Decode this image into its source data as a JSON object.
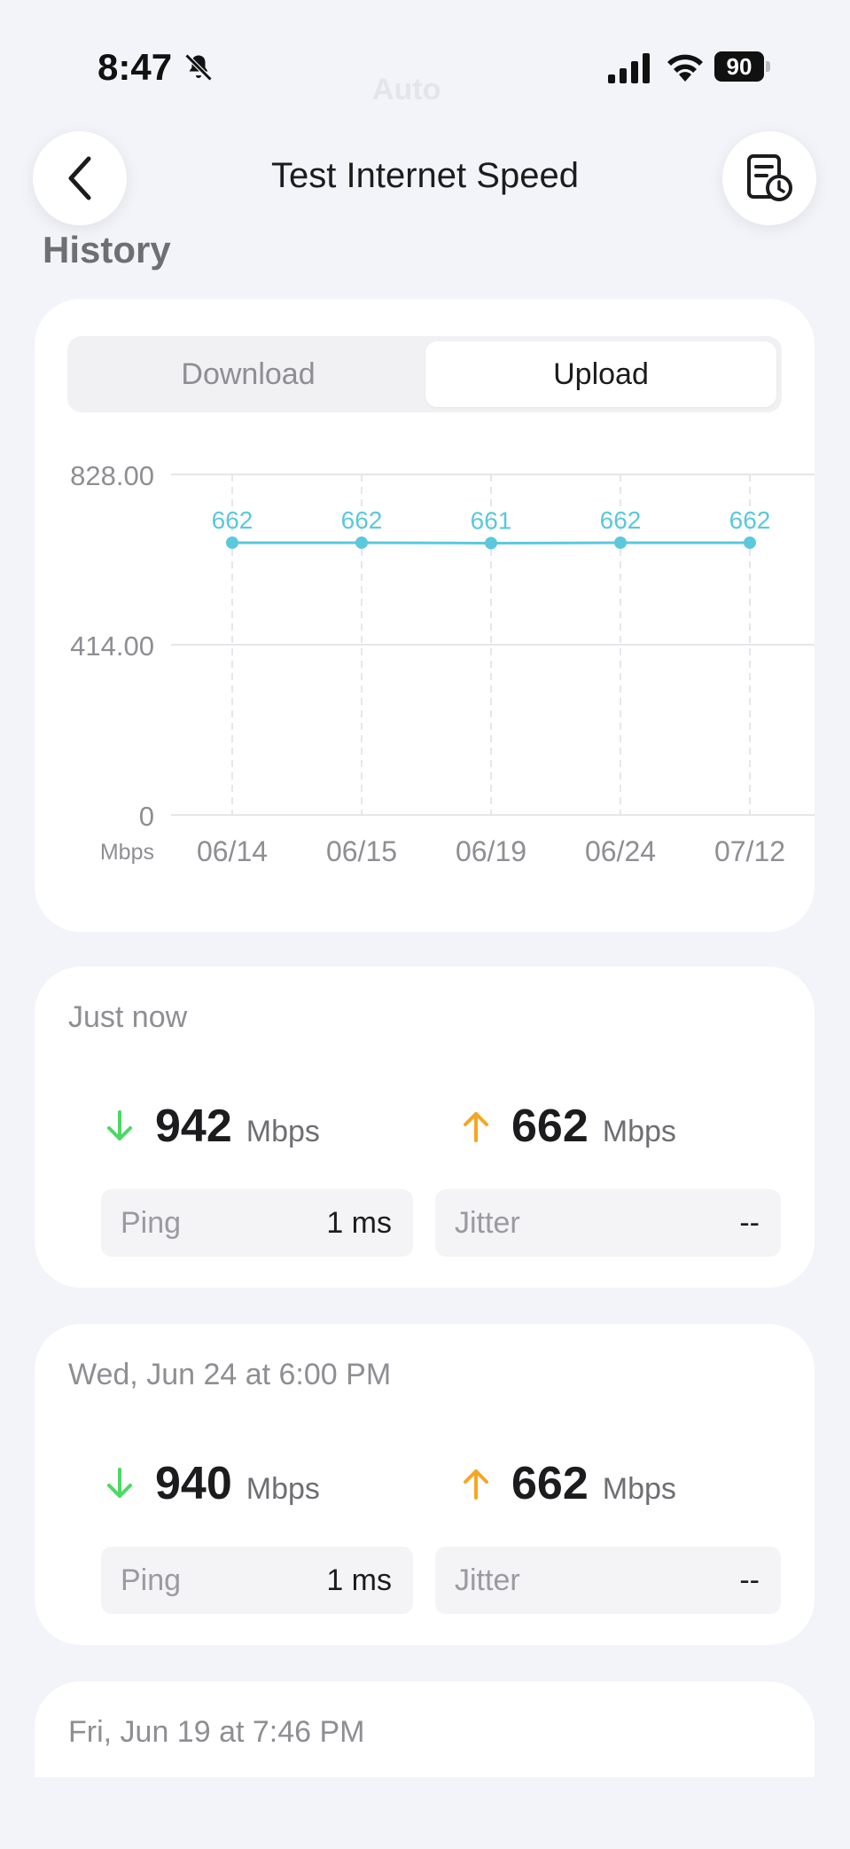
{
  "status_bar": {
    "time": "8:47",
    "battery": "90"
  },
  "faded_header": "Auto",
  "header": {
    "title": "Test Internet Speed",
    "back_icon": "chevron-left-icon",
    "history_icon": "report-history-icon"
  },
  "section_label": "History",
  "tabs": [
    {
      "label": "Download",
      "selected": false
    },
    {
      "label": "Upload",
      "selected": true
    }
  ],
  "chart_data": {
    "type": "line",
    "categories": [
      "06/14",
      "06/15",
      "06/19",
      "06/24",
      "07/12"
    ],
    "series": [
      {
        "values": [
          662,
          662,
          661,
          662,
          662
        ],
        "color": "#5bc8dc"
      }
    ],
    "y_ticks": [
      "828.00",
      "414.00",
      "0"
    ],
    "ylim": [
      0,
      828
    ],
    "y_unit": "Mbps",
    "grid": true
  },
  "results": [
    {
      "date": "Just now",
      "download": {
        "value": "942",
        "unit": "Mbps"
      },
      "upload": {
        "value": "662",
        "unit": "Mbps"
      },
      "ping": {
        "label": "Ping",
        "value": "1 ms"
      },
      "jitter": {
        "label": "Jitter",
        "value": "--"
      }
    },
    {
      "date": "Wed, Jun 24 at 6:00 PM",
      "download": {
        "value": "940",
        "unit": "Mbps"
      },
      "upload": {
        "value": "662",
        "unit": "Mbps"
      },
      "ping": {
        "label": "Ping",
        "value": "1 ms"
      },
      "jitter": {
        "label": "Jitter",
        "value": "--"
      }
    },
    {
      "date": "Fri, Jun 19 at 7:46 PM"
    }
  ],
  "colors": {
    "download_arrow": "#4cd964",
    "upload_arrow": "#f5a623",
    "line": "#5bc8dc"
  }
}
